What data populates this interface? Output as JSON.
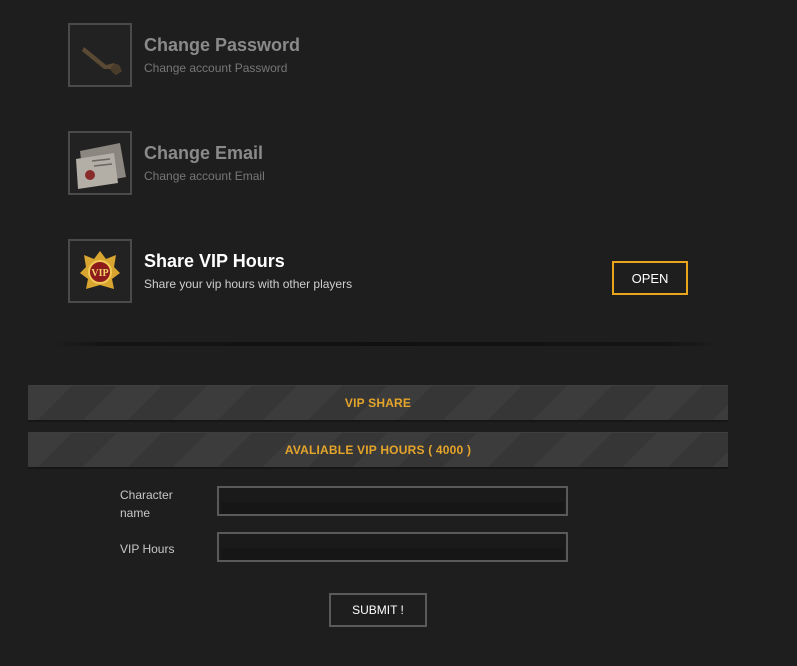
{
  "options": [
    {
      "title": "Change Password",
      "subtitle": "Change account Password",
      "icon": "key-icon"
    },
    {
      "title": "Change Email",
      "subtitle": "Change account Email",
      "icon": "letter-icon"
    },
    {
      "title": "Share VIP Hours",
      "subtitle": "Share your vip hours with other players",
      "icon": "vip-badge-icon",
      "button": "OPEN"
    }
  ],
  "vip_share": {
    "header": "VIP SHARE",
    "available": "AVALIABLE VIP HOURS ( 4000 )",
    "character_label": "Character name",
    "hours_label": "VIP Hours",
    "character_value": "",
    "hours_value": "",
    "submit": "SUBMIT !"
  },
  "colors": {
    "accent": "#e8a51c",
    "background": "#1e1e1e"
  }
}
